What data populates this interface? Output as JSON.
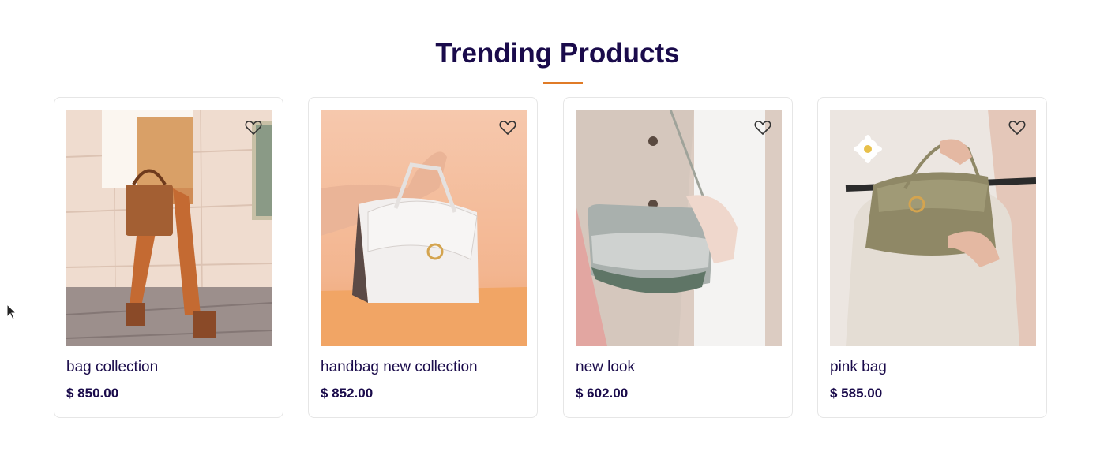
{
  "section": {
    "title": "Trending Products",
    "accent_color": "#e07b27",
    "title_color": "#1a0b4b"
  },
  "products": [
    {
      "name": "bag collection",
      "price": "$ 850.00",
      "wishlist_icon": "heart-outline-icon",
      "image": "woman-in-skirt-holding-brown-handbag"
    },
    {
      "name": "handbag new collection",
      "price": "$ 852.00",
      "wishlist_icon": "heart-outline-icon",
      "image": "hand-holding-white-handbag-on-peach-background"
    },
    {
      "name": "new look",
      "price": "$ 602.00",
      "wishlist_icon": "heart-outline-icon",
      "image": "woman-in-trench-coat-with-grey-crossbody-bag"
    },
    {
      "name": "pink bag",
      "price": "$ 585.00",
      "wishlist_icon": "heart-outline-icon",
      "image": "woman-holding-olive-handbag-with-flower"
    }
  ]
}
